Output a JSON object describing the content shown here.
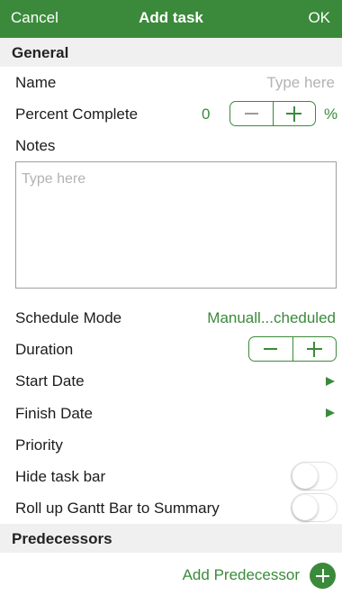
{
  "nav": {
    "cancel": "Cancel",
    "title": "Add task",
    "ok": "OK"
  },
  "general": {
    "header": "General",
    "name_label": "Name",
    "name_placeholder": "Type here",
    "percent_label": "Percent Complete",
    "percent_value": "0",
    "percent_unit": "%",
    "notes_label": "Notes",
    "notes_placeholder": "Type here",
    "schedule_mode_label": "Schedule Mode",
    "schedule_mode_value": "Manuall...cheduled",
    "duration_label": "Duration",
    "start_date_label": "Start Date",
    "finish_date_label": "Finish Date",
    "priority_label": "Priority",
    "hide_task_bar_label": "Hide task bar",
    "hide_task_bar_on": false,
    "rollup_label": "Roll up Gantt Bar to Summary",
    "rollup_on": false
  },
  "predecessors": {
    "header": "Predecessors",
    "add_label": "Add Predecessor"
  },
  "icons": {
    "minus": "minus-icon",
    "plus": "plus-icon",
    "disclosure": "triangle-right-icon",
    "add": "add-circle-icon"
  },
  "colors": {
    "accent": "#3b8a3b",
    "header_bg": "#f0f0f0",
    "placeholder": "#b3b3b3"
  }
}
